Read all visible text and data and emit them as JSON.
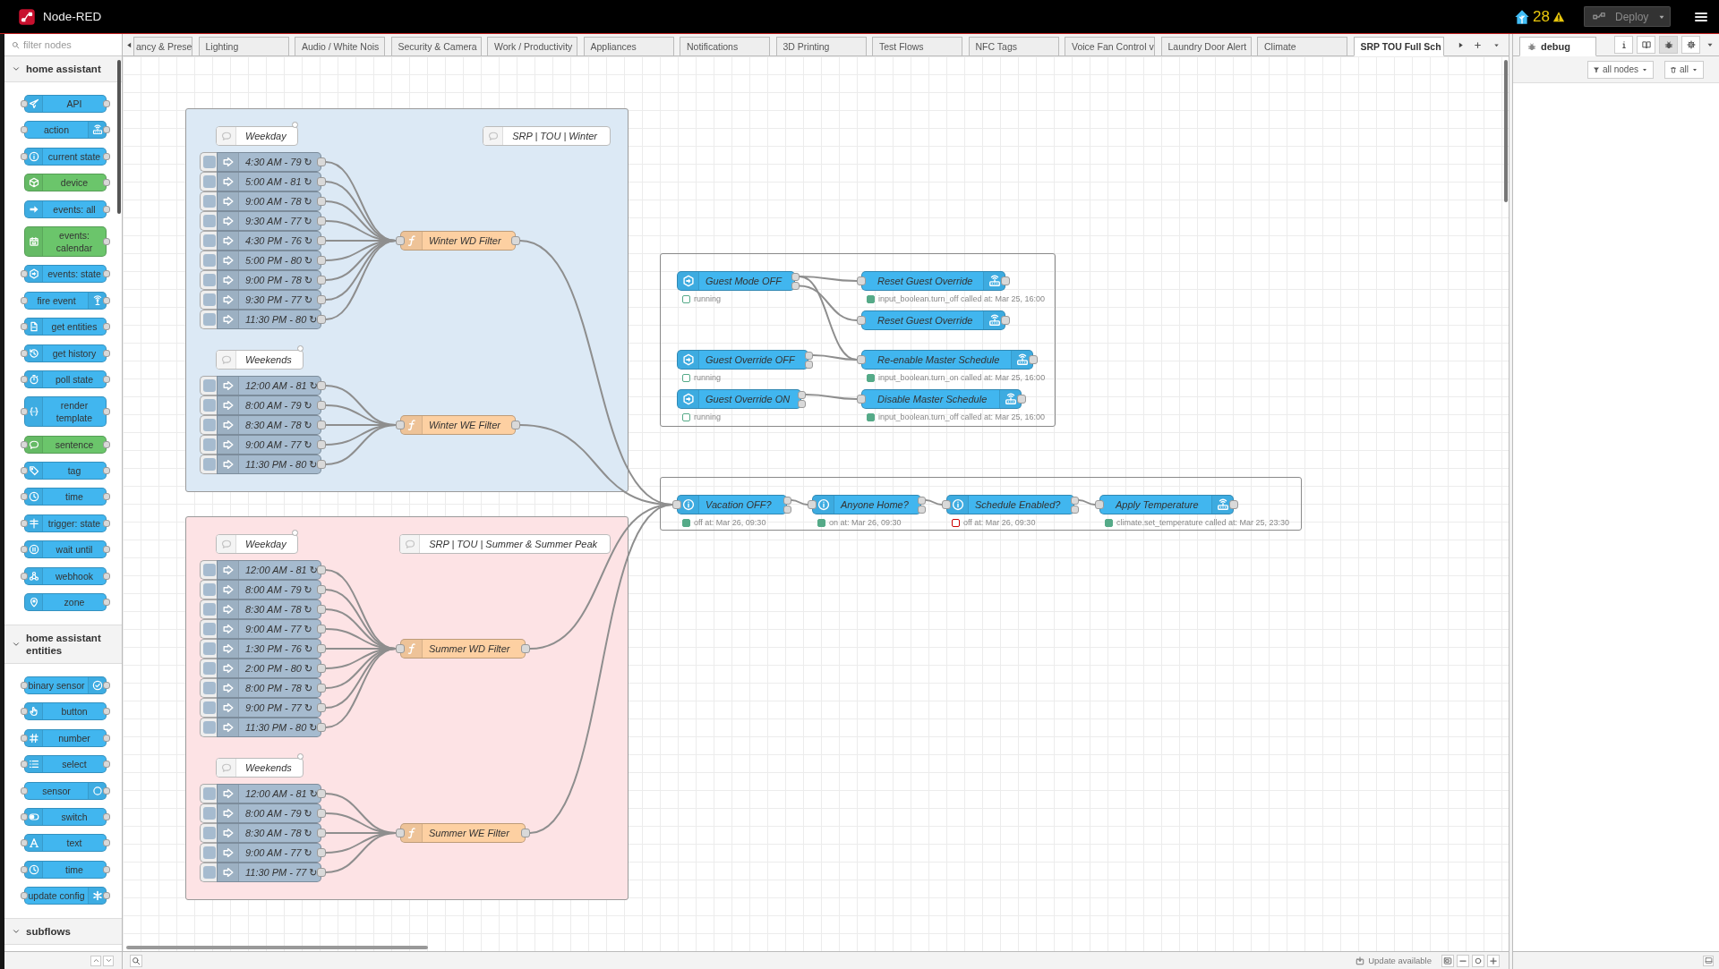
{
  "header": {
    "title": "Node-RED",
    "notification_count": "28",
    "deploy": {
      "label": "Deploy",
      "disabled": true
    }
  },
  "palette": {
    "filter_placeholder": "filter nodes",
    "categories": [
      {
        "title": "home assistant",
        "expanded": true,
        "nodes": [
          {
            "label": "API",
            "color": "#41b6ef"
          },
          {
            "label": "action",
            "color": "#41b6ef"
          },
          {
            "label": "current state",
            "color": "#41b6ef"
          },
          {
            "label": "device",
            "color": "#6bc56b"
          },
          {
            "label": "events: all",
            "color": "#41b6ef"
          },
          {
            "label": "events: calendar",
            "color": "#6bc56b"
          },
          {
            "label": "events: state",
            "color": "#41b6ef"
          },
          {
            "label": "fire event",
            "color": "#41b6ef"
          },
          {
            "label": "get entities",
            "color": "#41b6ef"
          },
          {
            "label": "get history",
            "color": "#41b6ef"
          },
          {
            "label": "poll state",
            "color": "#41b6ef"
          },
          {
            "label": "render template",
            "color": "#41b6ef"
          },
          {
            "label": "sentence",
            "color": "#6bc56b"
          },
          {
            "label": "tag",
            "color": "#41b6ef"
          },
          {
            "label": "time",
            "color": "#41b6ef"
          },
          {
            "label": "trigger: state",
            "color": "#41b6ef"
          },
          {
            "label": "wait until",
            "color": "#41b6ef"
          },
          {
            "label": "webhook",
            "color": "#41b6ef"
          },
          {
            "label": "zone",
            "color": "#41b6ef"
          }
        ]
      },
      {
        "title": "home assistant entities",
        "expanded": true,
        "nodes": [
          {
            "label": "binary sensor",
            "color": "#41b6ef"
          },
          {
            "label": "button",
            "color": "#41b6ef"
          },
          {
            "label": "number",
            "color": "#41b6ef"
          },
          {
            "label": "select",
            "color": "#41b6ef"
          },
          {
            "label": "sensor",
            "color": "#41b6ef"
          },
          {
            "label": "switch",
            "color": "#41b6ef"
          },
          {
            "label": "text",
            "color": "#41b6ef"
          },
          {
            "label": "time",
            "color": "#41b6ef"
          },
          {
            "label": "update config",
            "color": "#41b6ef"
          }
        ]
      },
      {
        "title": "subflows",
        "expanded": true
      }
    ]
  },
  "tabs": [
    {
      "label": "ancy & Prese",
      "selected": false
    },
    {
      "label": "Lighting",
      "selected": false
    },
    {
      "label": "Audio / White Nois",
      "selected": false
    },
    {
      "label": "Security & Camera",
      "selected": false
    },
    {
      "label": "Work / Productivity",
      "selected": false
    },
    {
      "label": "Appliances",
      "selected": false
    },
    {
      "label": "Notifications",
      "selected": false
    },
    {
      "label": "3D Printing",
      "selected": false
    },
    {
      "label": "Test Flows",
      "selected": false
    },
    {
      "label": "NFC Tags",
      "selected": false
    },
    {
      "label": "Voice Fan Control v",
      "selected": false
    },
    {
      "label": "Laundry Door Alert",
      "selected": false
    },
    {
      "label": "Climate",
      "selected": false
    },
    {
      "label": "SRP TOU Full Sch",
      "selected": true
    }
  ],
  "schedule_groups": [
    {
      "color": "#dce9f5",
      "title": "SRP | TOU | Winter",
      "sections": [
        {
          "comment": "Weekday",
          "injects": [
            "4:30 AM - 79 ↻",
            "5:00 AM - 81 ↻",
            "9:00 AM - 78 ↻",
            "9:30 AM - 77 ↻",
            "4:30 PM - 76 ↻",
            "5:00 PM - 80 ↻",
            "9:00 PM - 78 ↻",
            "9:30 PM - 77 ↻",
            "11:30 PM - 80 ↻"
          ],
          "filter": "Winter WD Filter"
        },
        {
          "comment": "Weekends",
          "injects": [
            "12:00 AM - 81 ↻",
            "8:00 AM - 79 ↻",
            "8:30 AM - 78 ↻",
            "9:00 AM - 77 ↻",
            "11:30 PM - 80 ↻"
          ],
          "filter": "Winter WE Filter"
        }
      ]
    },
    {
      "color": "#fde3e5",
      "title": "SRP | TOU | Summer & Summer Peak",
      "sections": [
        {
          "comment": "Weekday",
          "injects": [
            "12:00 AM - 81 ↻",
            "8:00 AM - 79 ↻",
            "8:30 AM - 78 ↻",
            "9:00 AM - 77 ↻",
            "1:30 PM - 76 ↻",
            "2:00 PM - 80 ↻",
            "8:00 PM - 78 ↻",
            "9:00 PM - 77 ↻",
            "11:30 PM - 80 ↻"
          ],
          "filter": "Summer WD Filter"
        },
        {
          "comment": "Weekends",
          "injects": [
            "12:00 AM - 81 ↻",
            "8:00 AM - 79 ↻",
            "8:30 AM - 78 ↻",
            "9:00 AM - 77 ↻",
            "11:30 PM - 77 ↻"
          ],
          "filter": "Summer WE Filter"
        }
      ]
    }
  ],
  "guest_group": {
    "rows": [
      {
        "trigger": {
          "kind": "trigger",
          "label": "Guest Mode OFF",
          "status": {
            "text": "running",
            "color": "#55aa88",
            "filled": false
          }
        },
        "action": {
          "kind": "action",
          "label": "Reset Guest Override",
          "status": {
            "text": "input_boolean.turn_off called at: Mar 25, 16:00",
            "color": "#55aa88",
            "filled": true
          }
        }
      },
      {
        "action": {
          "kind": "action",
          "label": "Reset Guest Override"
        }
      },
      {
        "trigger": {
          "kind": "trigger",
          "label": "Guest Override OFF",
          "status": {
            "text": "running",
            "color": "#55aa88",
            "filled": false
          }
        },
        "action": {
          "kind": "action",
          "label": "Re-enable Master Schedule",
          "status": {
            "text": "input_boolean.turn_on called at: Mar 25, 16:00",
            "color": "#55aa88",
            "filled": true
          }
        }
      },
      {
        "trigger": {
          "kind": "trigger",
          "label": "Guest Override ON",
          "status": {
            "text": "running",
            "color": "#55aa88",
            "filled": false
          }
        },
        "action": {
          "kind": "action",
          "label": "Disable Master Schedule",
          "status": {
            "text": "input_boolean.turn_off called at: Mar 25, 16:00",
            "color": "#55aa88",
            "filled": true
          }
        }
      }
    ]
  },
  "climate_chain": {
    "nodes": [
      {
        "kind": "check",
        "label": "Vacation OFF?",
        "status": {
          "text": "off at: Mar 26, 09:30",
          "color": "#55aa88",
          "filled": true
        }
      },
      {
        "kind": "check",
        "label": "Anyone Home?",
        "status": {
          "text": "on at: Mar 26, 09:30",
          "color": "#55aa88",
          "filled": true
        }
      },
      {
        "kind": "check",
        "label": "Schedule Enabled?",
        "status": {
          "text": "off at: Mar 26, 09:30",
          "color": "#cc0000",
          "filled": false
        }
      },
      {
        "kind": "action",
        "label": "Apply Temperature",
        "status": {
          "text": "climate.set_temperature called at: Mar 25, 23:30",
          "color": "#55aa88",
          "filled": true
        }
      }
    ]
  },
  "canvas_toolbar": {
    "update_label": "Update available"
  },
  "sidebar": {
    "tab": {
      "label": "debug",
      "selected": true
    },
    "buttons": [
      {
        "selected": false
      },
      {
        "selected": false
      },
      {
        "selected": true
      },
      {
        "selected": false
      }
    ],
    "filter_label": "all nodes",
    "clear_label": "all"
  }
}
